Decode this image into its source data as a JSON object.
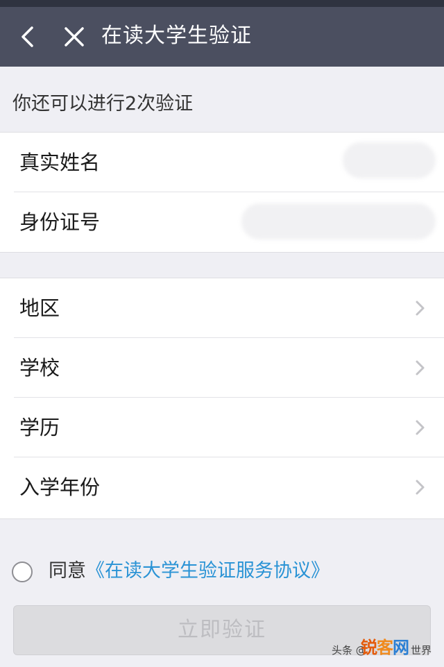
{
  "nav": {
    "title": "在读大学生验证",
    "back_icon": "chevron-left-icon",
    "close_icon": "close-icon"
  },
  "notice": {
    "remaining_text": "你还可以进行2次验证"
  },
  "identity_fields": [
    {
      "label": "真实姓名"
    },
    {
      "label": "身份证号"
    }
  ],
  "school_fields": [
    {
      "label": "地区"
    },
    {
      "label": "学校"
    },
    {
      "label": "学历"
    },
    {
      "label": "入学年份"
    }
  ],
  "agreement": {
    "prefix": "同意",
    "link_text": "《在读大学生验证服务协议》"
  },
  "submit": {
    "label": "立即验证"
  },
  "watermark": {
    "source": "头条 @",
    "logo_part1": "锐",
    "logo_part2": "客",
    "logo_part3": "网",
    "tail": "世界"
  },
  "colors": {
    "nav_bg": "#4b4f60",
    "link": "#2a93d5",
    "page_bg": "#efeff4",
    "button_disabled_bg": "#dcdcdf",
    "button_disabled_text": "#bdbdc1"
  }
}
